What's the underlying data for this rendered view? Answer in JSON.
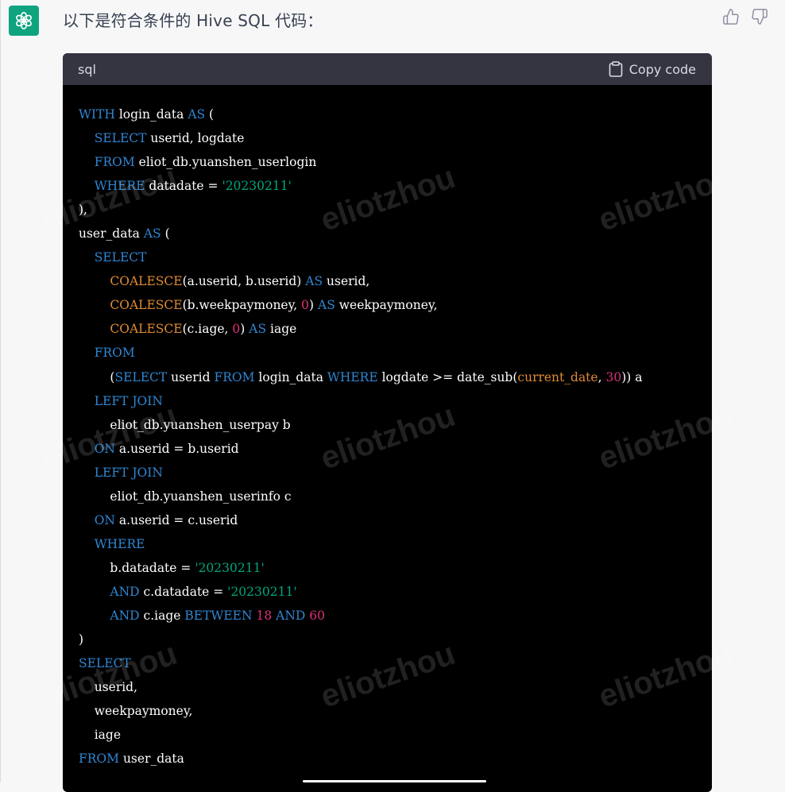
{
  "message": {
    "intro": "以下是符合条件的 Hive SQL 代码：",
    "avatar_icon": "openai-logo-icon",
    "brand_color": "#10a37f"
  },
  "feedback": {
    "thumbs_up_icon": "thumbs-up-icon",
    "thumbs_down_icon": "thumbs-down-icon"
  },
  "code_block": {
    "language": "sql",
    "copy_label": "Copy code",
    "lines": [
      [
        [
          "kw",
          "WITH"
        ],
        [
          "t",
          " login_data "
        ],
        [
          "kw",
          "AS"
        ],
        [
          "t",
          " ("
        ]
      ],
      [
        [
          "t",
          "    "
        ],
        [
          "kw",
          "SELECT"
        ],
        [
          "t",
          " userid, logdate"
        ]
      ],
      [
        [
          "t",
          "    "
        ],
        [
          "kw",
          "FROM"
        ],
        [
          "t",
          " eliot_db.yuanshen_userlogin"
        ]
      ],
      [
        [
          "t",
          "    "
        ],
        [
          "kw",
          "WHERE"
        ],
        [
          "t",
          " datadate = "
        ],
        [
          "str",
          "'20230211'"
        ]
      ],
      [
        [
          "t",
          "),"
        ]
      ],
      [
        [
          "t",
          "user_data "
        ],
        [
          "kw",
          "AS"
        ],
        [
          "t",
          " ("
        ]
      ],
      [
        [
          "t",
          "    "
        ],
        [
          "kw",
          "SELECT"
        ]
      ],
      [
        [
          "t",
          "        "
        ],
        [
          "fn",
          "COALESCE"
        ],
        [
          "t",
          "(a.userid, b.userid) "
        ],
        [
          "kw",
          "AS"
        ],
        [
          "t",
          " userid,"
        ]
      ],
      [
        [
          "t",
          "        "
        ],
        [
          "fn",
          "COALESCE"
        ],
        [
          "t",
          "(b.weekpaymoney, "
        ],
        [
          "num",
          "0"
        ],
        [
          "t",
          ") "
        ],
        [
          "kw",
          "AS"
        ],
        [
          "t",
          " weekpaymoney,"
        ]
      ],
      [
        [
          "t",
          "        "
        ],
        [
          "fn",
          "COALESCE"
        ],
        [
          "t",
          "(c.iage, "
        ],
        [
          "num",
          "0"
        ],
        [
          "t",
          ") "
        ],
        [
          "kw",
          "AS"
        ],
        [
          "t",
          " iage"
        ]
      ],
      [
        [
          "t",
          "    "
        ],
        [
          "kw",
          "FROM"
        ]
      ],
      [
        [
          "t",
          "        ("
        ],
        [
          "kw",
          "SELECT"
        ],
        [
          "t",
          " userid "
        ],
        [
          "kw",
          "FROM"
        ],
        [
          "t",
          " login_data "
        ],
        [
          "kw",
          "WHERE"
        ],
        [
          "t",
          " logdate >= date_sub("
        ],
        [
          "fn",
          "current_date"
        ],
        [
          "t",
          ", "
        ],
        [
          "num",
          "30"
        ],
        [
          "t",
          ")) a"
        ]
      ],
      [
        [
          "t",
          "    "
        ],
        [
          "kw",
          "LEFT JOIN"
        ]
      ],
      [
        [
          "t",
          "        eliot_db.yuanshen_userpay b"
        ]
      ],
      [
        [
          "t",
          "    "
        ],
        [
          "kw",
          "ON"
        ],
        [
          "t",
          " a.userid = b.userid"
        ]
      ],
      [
        [
          "t",
          "    "
        ],
        [
          "kw",
          "LEFT JOIN"
        ]
      ],
      [
        [
          "t",
          "        eliot_db.yuanshen_userinfo c"
        ]
      ],
      [
        [
          "t",
          "    "
        ],
        [
          "kw",
          "ON"
        ],
        [
          "t",
          " a.userid = c.userid"
        ]
      ],
      [
        [
          "t",
          "    "
        ],
        [
          "kw",
          "WHERE"
        ]
      ],
      [
        [
          "t",
          "        b.datadate = "
        ],
        [
          "str",
          "'20230211'"
        ]
      ],
      [
        [
          "t",
          "        "
        ],
        [
          "kw",
          "AND"
        ],
        [
          "t",
          " c.datadate = "
        ],
        [
          "str",
          "'20230211'"
        ]
      ],
      [
        [
          "t",
          "        "
        ],
        [
          "kw",
          "AND"
        ],
        [
          "t",
          " c.iage "
        ],
        [
          "kw",
          "BETWEEN"
        ],
        [
          "t",
          " "
        ],
        [
          "num",
          "18"
        ],
        [
          "t",
          " "
        ],
        [
          "kw",
          "AND"
        ],
        [
          "t",
          " "
        ],
        [
          "num",
          "60"
        ]
      ],
      [
        [
          "t",
          ")"
        ]
      ],
      [
        [
          "kw",
          "SELECT"
        ]
      ],
      [
        [
          "t",
          "    userid,"
        ]
      ],
      [
        [
          "t",
          "    weekpaymoney,"
        ]
      ],
      [
        [
          "t",
          "    iage"
        ]
      ],
      [
        [
          "kw",
          "FROM"
        ],
        [
          "t",
          " user_data"
        ]
      ]
    ]
  },
  "watermark": {
    "text": "eliotzhou"
  }
}
